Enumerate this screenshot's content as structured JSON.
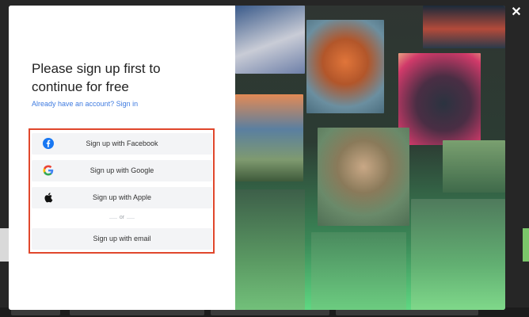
{
  "modal": {
    "title": "Please sign up first to continue for free",
    "signin_link": "Already have an account? Sign in",
    "buttons": {
      "facebook": "Sign up with Facebook",
      "google": "Sign up with Google",
      "apple": "Sign up with Apple",
      "email": "Sign up with email"
    },
    "divider": "or"
  },
  "icons": {
    "close": "close-icon",
    "facebook": "facebook-icon",
    "google": "google-icon",
    "apple": "apple-icon"
  },
  "colors": {
    "accent_link": "#3f7be0",
    "highlight_border": "#e0472c",
    "facebook_blue": "#1877f2",
    "button_bg": "#f3f4f6"
  }
}
